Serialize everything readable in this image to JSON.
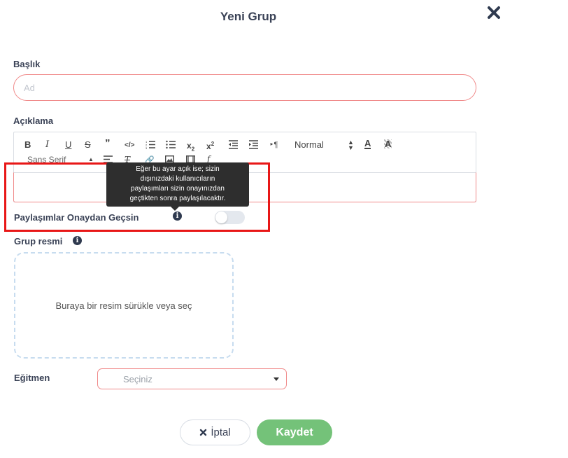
{
  "dialog": {
    "title": "Yeni Grup",
    "close_icon": "close-x-icon"
  },
  "fields": {
    "title_label": "Başlık",
    "title_placeholder": "Ad",
    "description_label": "Açıklama",
    "approval_label": "Paylaşımlar Onaydan Geçsin",
    "approval_enabled": false,
    "image_label": "Grup resmi",
    "dropzone_text": "Buraya bir resim sürükle veya seç",
    "trainer_label": "Eğitmen",
    "trainer_placeholder": "Seçiniz"
  },
  "toolbar": {
    "row1": [
      "B",
      "I",
      "U",
      "S",
      "99",
      "</>",
      "ol",
      "ul",
      "x2-sub",
      "x2-sup",
      "outdent",
      "indent",
      "rtl"
    ],
    "size_select": "Normal",
    "font_select": "Sans Serif"
  },
  "tooltip": {
    "lines": [
      "Eğer bu ayar açık ise; sizin",
      "dışınızdaki kullanıcıların",
      "paylaşımları sizin onayınızdan",
      "geçtikten sonra paylaşılacaktır."
    ]
  },
  "actions": {
    "cancel_label": "İptal",
    "save_label": "Kaydet"
  },
  "colors": {
    "accent_green": "#74c279",
    "error_red": "#f08a8a",
    "highlight_red": "#e81717",
    "text_dark": "#3a4256"
  }
}
